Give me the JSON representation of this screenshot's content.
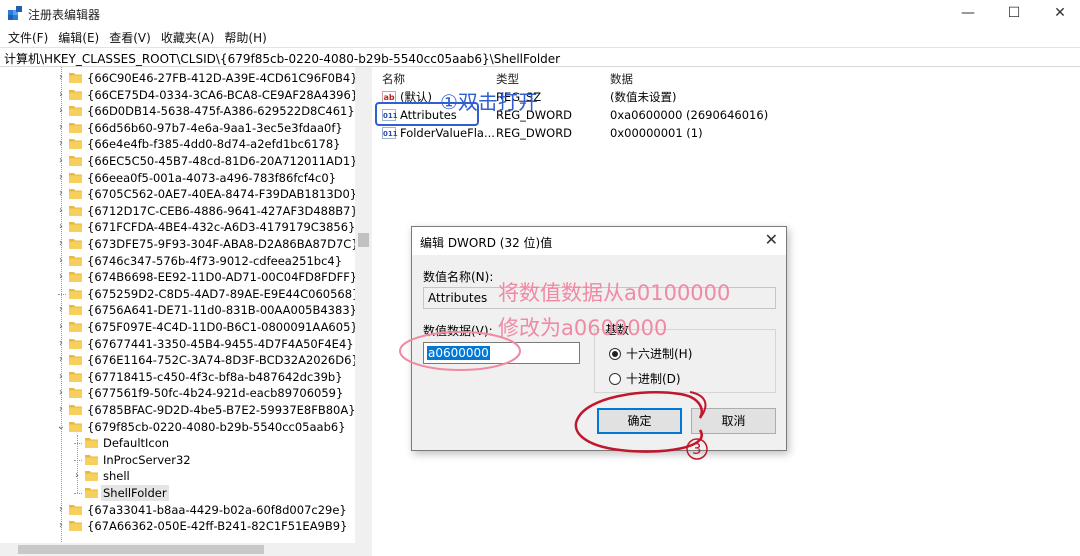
{
  "window": {
    "title": "注册表编辑器",
    "minimize_glyph": "—",
    "maximize_glyph": "☐",
    "close_glyph": "✕"
  },
  "menu": [
    "文件(F)",
    "编辑(E)",
    "查看(V)",
    "收藏夹(A)",
    "帮助(H)"
  ],
  "address": "计算机\\HKEY_CLASSES_ROOT\\CLSID\\{679f85cb-0220-4080-b29b-5540cc05aab6}\\ShellFolder",
  "tree": {
    "items": [
      {
        "label": "{66C90E46-27FB-412D-A39E-4CD61C96F0B4}",
        "depth": 0,
        "chevron": ">"
      },
      {
        "label": "{66CE75D4-0334-3CA6-BCA8-CE9AF28A4396}",
        "depth": 0,
        "chevron": ">"
      },
      {
        "label": "{66D0DB14-5638-475f-A386-629522D8C461}",
        "depth": 0,
        "chevron": ">"
      },
      {
        "label": "{66d56b60-97b7-4e6a-9aa1-3ec5e3fdaa0f}",
        "depth": 0,
        "chevron": ">"
      },
      {
        "label": "{66e4e4fb-f385-4dd0-8d74-a2efd1bc6178}",
        "depth": 0,
        "chevron": ">"
      },
      {
        "label": "{66EC5C50-45B7-48cd-81D6-20A712011AD1}",
        "depth": 0,
        "chevron": ">"
      },
      {
        "label": "{66eea0f5-001a-4073-a496-783f86fcf4c0}",
        "depth": 0,
        "chevron": ">"
      },
      {
        "label": "{6705C562-0AE7-40EA-8474-F39DAB1813D0}",
        "depth": 0,
        "chevron": ">"
      },
      {
        "label": "{6712D17C-CEB6-4886-9641-427AF3D488B7}",
        "depth": 0,
        "chevron": ">"
      },
      {
        "label": "{671FCFDA-4BE4-432c-A6D3-4179179C3856}",
        "depth": 0,
        "chevron": ">"
      },
      {
        "label": "{673DFE75-9F93-304F-ABA8-D2A86BA87D7C}",
        "depth": 0,
        "chevron": ">"
      },
      {
        "label": "{6746c347-576b-4f73-9012-cdfeea251bc4}",
        "depth": 0,
        "chevron": ">"
      },
      {
        "label": "{674B6698-EE92-11D0-AD71-00C04FD8FDFF}",
        "depth": 0,
        "chevron": ">"
      },
      {
        "label": "{675259D2-C8D5-4AD7-89AE-E9E44C060568}",
        "depth": 0,
        "chevron": ""
      },
      {
        "label": "{6756A641-DE71-11d0-831B-00AA005B4383}",
        "depth": 0,
        "chevron": ">"
      },
      {
        "label": "{675F097E-4C4D-11D0-B6C1-0800091AA605}",
        "depth": 0,
        "chevron": ">"
      },
      {
        "label": "{67677441-3350-45B4-9455-4D7F4A50F4E4}",
        "depth": 0,
        "chevron": ">"
      },
      {
        "label": "{676E1164-752C-3A74-8D3F-BCD32A2026D6}",
        "depth": 0,
        "chevron": ">"
      },
      {
        "label": "{67718415-c450-4f3c-bf8a-b487642dc39b}",
        "depth": 0,
        "chevron": ">"
      },
      {
        "label": "{677561f9-50fc-4b24-921d-eacb89706059}",
        "depth": 0,
        "chevron": ">"
      },
      {
        "label": "{6785BFAC-9D2D-4be5-B7E2-59937E8FB80A}",
        "depth": 0,
        "chevron": ">"
      },
      {
        "label": "{679f85cb-0220-4080-b29b-5540cc05aab6}",
        "depth": 0,
        "chevron": "v"
      },
      {
        "label": "DefaultIcon",
        "depth": 1,
        "chevron": ""
      },
      {
        "label": "InProcServer32",
        "depth": 1,
        "chevron": ""
      },
      {
        "label": "shell",
        "depth": 1,
        "chevron": ">"
      },
      {
        "label": "ShellFolder",
        "depth": 1,
        "chevron": "",
        "selected": true
      },
      {
        "label": "{67a33041-b8aa-4429-b02a-60f8d007c29e}",
        "depth": 0,
        "chevron": ">"
      },
      {
        "label": "{67A66362-050E-42ff-B241-82C1F51EA9B9}",
        "depth": 0,
        "chevron": ">"
      }
    ]
  },
  "values": {
    "headers": {
      "name": "名称",
      "type": "类型",
      "data": "数据"
    },
    "rows": [
      {
        "icon": "ab",
        "name": "(默认)",
        "type": "REG_SZ",
        "data": "(数值未设置)"
      },
      {
        "icon": "bin",
        "name": "Attributes",
        "type": "REG_DWORD",
        "data": "0xa0600000 (2690646016)"
      },
      {
        "icon": "bin",
        "name": "FolderValueFla...",
        "type": "REG_DWORD",
        "data": "0x00000001 (1)"
      }
    ]
  },
  "dialog": {
    "title": "编辑 DWORD (32 位)值",
    "close_glyph": "✕",
    "name_label": "数值名称(N):",
    "name_value": "Attributes",
    "data_label": "数值数据(V):",
    "data_value": "a0600000",
    "base_label": "基数",
    "base_hex": "十六进制(H)",
    "base_dec": "十进制(D)",
    "ok": "确定",
    "cancel": "取消"
  },
  "annotations": {
    "step1": "①双击打开",
    "note_line1": "将数值数据从a0100000",
    "note_line2": "修改为a0600000",
    "step3": "3"
  },
  "colors": {
    "annotation_blue": "#2f5fd0",
    "annotation_pink": "#f08aa3",
    "annotation_red": "#c0172d",
    "selection_blue": "#0078d7",
    "folder_yellow": "#e8b93a"
  }
}
